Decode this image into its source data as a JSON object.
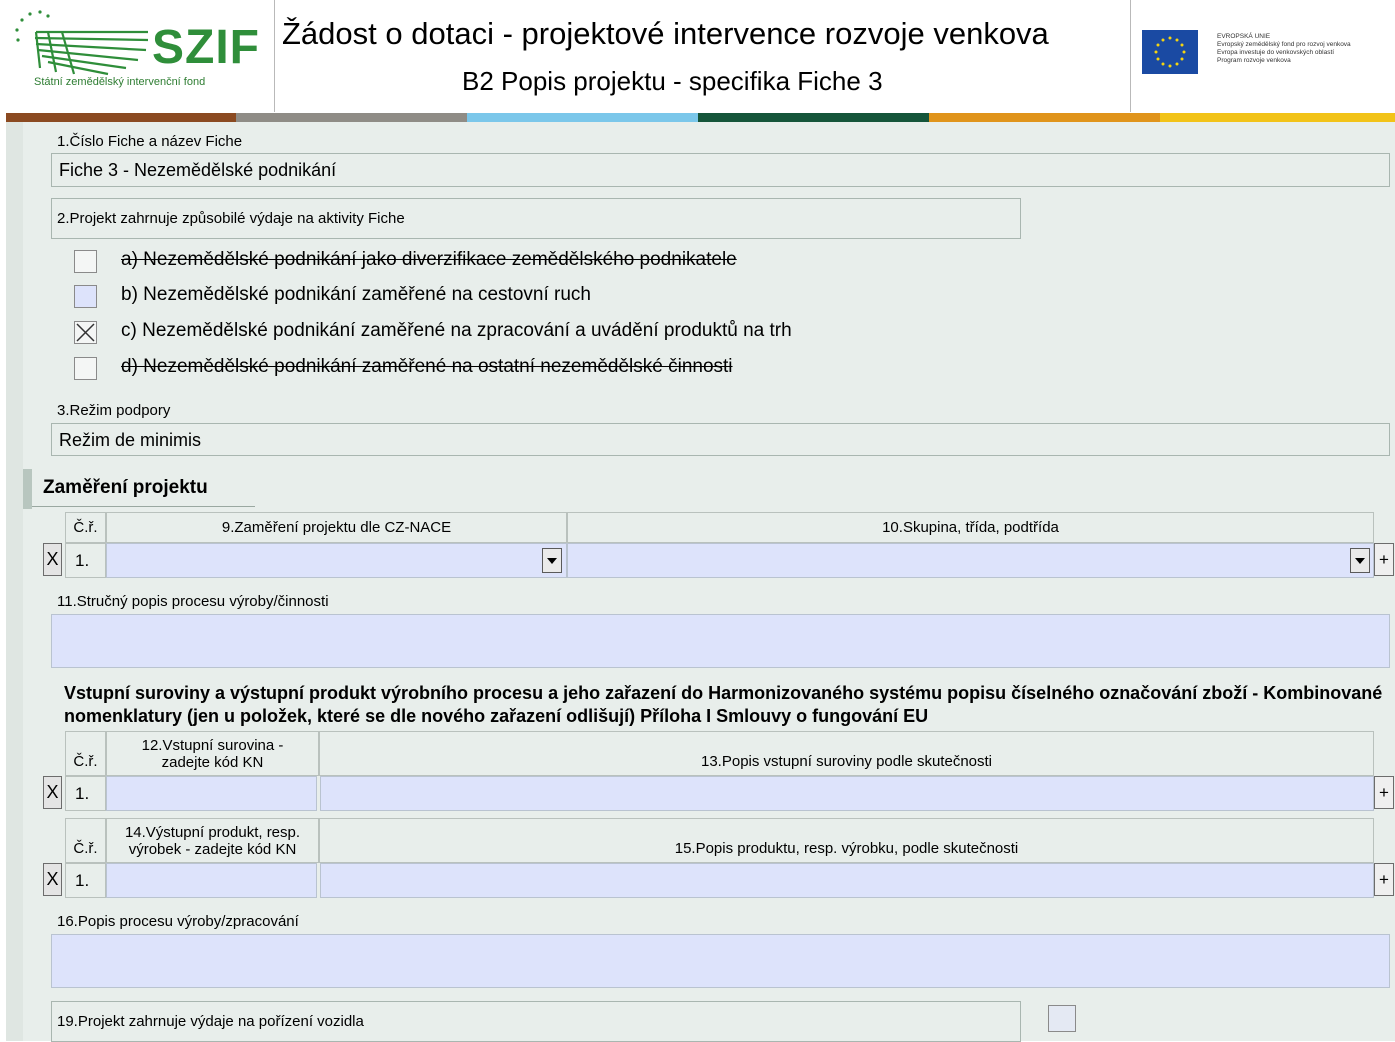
{
  "header": {
    "logo_name": "SZIF",
    "logo_subtitle": "Státní zemědělský intervenční fond",
    "title": "Žádost o dotaci - projektové intervence rozvoje venkova",
    "subtitle": "B2 Popis projektu - specifika Fiche 3",
    "eu_lines": [
      "EVROPSKÁ UNIE",
      "Evropský zemědělský fond pro rozvoj venkova",
      "Evropa investuje do venkovských oblastí",
      "Program rozvoje venkova"
    ]
  },
  "stripe_colors": [
    "#8b4a21",
    "#8f8c86",
    "#7bc7ea",
    "#15553a",
    "#e0941b",
    "#f2c318"
  ],
  "form": {
    "f1_label": "1.Číslo Fiche a název Fiche",
    "f1_value": "Fiche 3 - Nezemědělské podnikání",
    "f2_label": "2.Projekt zahrnuje způsobilé výdaje na aktivity Fiche",
    "options": [
      {
        "label": "a) Nezemědělské podnikání jako diverzifikace zemědělského podnikatele",
        "checked": false,
        "struck": true
      },
      {
        "label": "b) Nezemědělské podnikání zaměřené na cestovní ruch",
        "checked": false,
        "struck": false
      },
      {
        "label": "c) Nezemědělské podnikání zaměřené na zpracování a uvádění produktů na trh",
        "checked": true,
        "struck": false
      },
      {
        "label": "d) Nezemědělské podnikání zaměřené na ostatní nezemědělské činnosti",
        "checked": false,
        "struck": true
      }
    ],
    "f3_label": "3.Režim podpory",
    "f3_value": "Režim de minimis",
    "section_title": "Zaměření projektu",
    "t1": {
      "col_nr": "Č.ř.",
      "col9": "9.Zaměření projektu dle CZ-NACE",
      "col10": "10.Skupina, třída, podtřída",
      "row_nr": "1."
    },
    "f11_label": "11.Stručný popis procesu výroby/činnosti",
    "para": "Vstupní suroviny a výstupní produkt výrobního procesu a jeho zařazení do Harmonizovaného systému popisu číselného označování zboží - Kombinované nomenklatury (jen u položek, které se dle nového zařazení odlišují) Příloha I Smlouvy o fungování EU",
    "t2": {
      "col_nr": "Č.ř.",
      "col12": "12.Vstupní surovina - zadejte kód KN",
      "col13": "13.Popis vstupní suroviny podle skutečnosti",
      "row_nr": "1."
    },
    "t3": {
      "col_nr": "Č.ř.",
      "col14": "14.Výstupní produkt, resp. výrobek - zadejte kód KN",
      "col15": "15.Popis produktu, resp. výrobku, podle skutečnosti",
      "row_nr": "1."
    },
    "f16_label": "16.Popis procesu výroby/zpracování",
    "f19_label": "19.Projekt zahrnuje výdaje na pořízení vozidla",
    "btn_remove": "X",
    "btn_add": "+"
  }
}
